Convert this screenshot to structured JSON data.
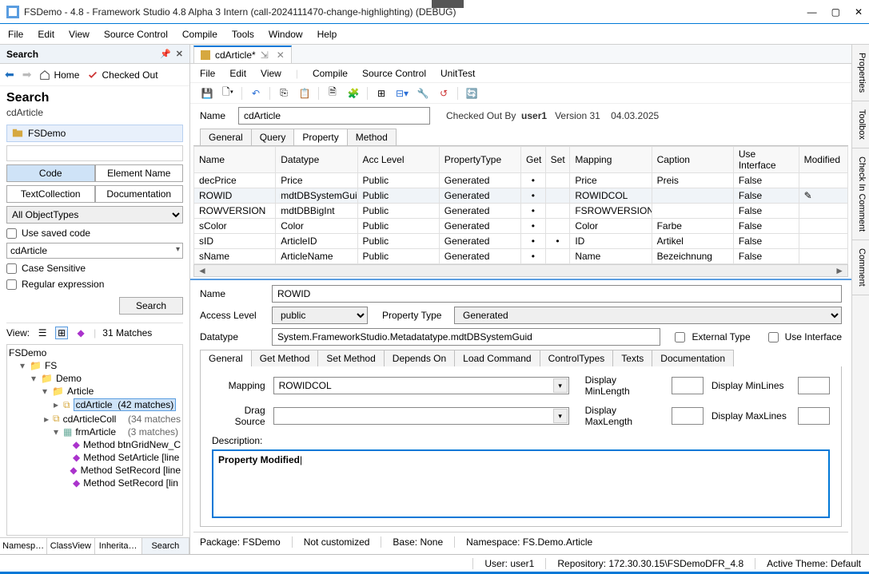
{
  "window": {
    "title": "FSDemo - 4.8 - Framework Studio 4.8 Alpha 3 Intern (call-2024111470-change-highlighting) (DEBUG)"
  },
  "menubar": [
    "File",
    "Edit",
    "View",
    "Source Control",
    "Compile",
    "Tools",
    "Window",
    "Help"
  ],
  "search": {
    "panel_title": "Search",
    "home": "Home",
    "checked_out": "Checked Out",
    "title": "Search",
    "subtitle": "cdArticle",
    "repo": "FSDemo",
    "tog_code": "Code",
    "tog_elem": "Element Name",
    "tog_textcoll": "TextCollection",
    "tog_doc": "Documentation",
    "objtypes": "All ObjectTypes",
    "use_saved": "Use saved code",
    "term": "cdArticle",
    "case": "Case Sensitive",
    "regex": "Regular expression",
    "btn": "Search",
    "view_label": "View:",
    "matches": "31 Matches"
  },
  "tree": {
    "root": "FSDemo",
    "fs": "FS",
    "demo": "Demo",
    "article": "Article",
    "cdArticle": "cdArticle",
    "cdArticle_m": "(42 matches)",
    "cdArticleColl": "cdArticleColl",
    "cdArticleColl_m": "(34 matches",
    "frmArticle": "frmArticle",
    "frmArticle_m": "(3 matches)",
    "m1": "Method btnGridNew_C",
    "m2": "Method SetArticle [line",
    "m3": "Method SetRecord [line",
    "m4": "Method SetRecord [lin"
  },
  "left_tabs": [
    "Namesp…",
    "ClassView",
    "Inherita…",
    "Search"
  ],
  "doc": {
    "tab": "cdArticle*",
    "submenu": [
      "File",
      "Edit",
      "View",
      "Compile",
      "Source Control",
      "UnitTest"
    ],
    "name_label": "Name",
    "name_value": "cdArticle",
    "checked_label": "Checked Out By",
    "checked_user": "user1",
    "version_label": "Version 31",
    "date": "04.03.2025"
  },
  "proptabs": [
    "General",
    "Query",
    "Property",
    "Method"
  ],
  "grid": {
    "cols": [
      "Name",
      "Datatype",
      "Acc Level",
      "PropertyType",
      "Get",
      "Set",
      "Mapping",
      "Caption",
      "Use Interface",
      "Modified"
    ],
    "rows": [
      {
        "n": "decPrice",
        "d": "Price",
        "a": "Public",
        "p": "Generated",
        "g": "•",
        "s": "",
        "m": "Price",
        "c": "Preis",
        "u": "False",
        "mod": ""
      },
      {
        "n": "ROWID",
        "d": "mdtDBSystemGuid",
        "a": "Public",
        "p": "Generated",
        "g": "•",
        "s": "",
        "m": "ROWIDCOL",
        "c": "",
        "u": "False",
        "mod": "✎"
      },
      {
        "n": "ROWVERSION",
        "d": "mdtDBBigInt",
        "a": "Public",
        "p": "Generated",
        "g": "•",
        "s": "",
        "m": "FSROWVERSION",
        "c": "",
        "u": "False",
        "mod": ""
      },
      {
        "n": "sColor",
        "d": "Color",
        "a": "Public",
        "p": "Generated",
        "g": "•",
        "s": "",
        "m": "Color",
        "c": "Farbe",
        "u": "False",
        "mod": ""
      },
      {
        "n": "sID",
        "d": "ArticleID",
        "a": "Public",
        "p": "Generated",
        "g": "•",
        "s": "•",
        "m": "ID",
        "c": "Artikel",
        "u": "False",
        "mod": ""
      },
      {
        "n": "sName",
        "d": "ArticleName",
        "a": "Public",
        "p": "Generated",
        "g": "•",
        "s": "",
        "m": "Name",
        "c": "Bezeichnung",
        "u": "False",
        "mod": ""
      }
    ]
  },
  "form": {
    "name_l": "Name",
    "name_v": "ROWID",
    "acc_l": "Access Level",
    "acc_v": "public",
    "ptype_l": "Property Type",
    "ptype_v": "Generated",
    "dtype_l": "Datatype",
    "dtype_v": "System.FrameworkStudio.Metadatatype.mdtDBSystemGuid",
    "ext_type": "External Type",
    "use_iface": "Use Interface"
  },
  "subtabs": [
    "General",
    "Get Method",
    "Set Method",
    "Depends On",
    "Load Command",
    "ControlTypes",
    "Texts",
    "Documentation"
  ],
  "sub": {
    "mapping_l": "Mapping",
    "mapping_v": "ROWIDCOL",
    "drag_l": "Drag Source",
    "drag_v": "",
    "minlen_l": "Display MinLength",
    "minlines_l": "Display MinLines",
    "maxlen_l": "Display MaxLength",
    "maxlines_l": "Display MaxLines",
    "desc_l": "Description:",
    "desc_v": "Property Modified"
  },
  "bottom": {
    "pkg": "Package: FSDemo",
    "cust": "Not customized",
    "base": "Base: None",
    "ns": "Namespace: FS.Demo.Article"
  },
  "right": [
    "Properties",
    "Toolbox",
    "Check In Comment",
    "Comment"
  ],
  "status": {
    "user": "User: user1",
    "repo": "Repository: 172.30.30.15\\FSDemoDFR_4.8",
    "theme": "Active Theme: Default"
  }
}
